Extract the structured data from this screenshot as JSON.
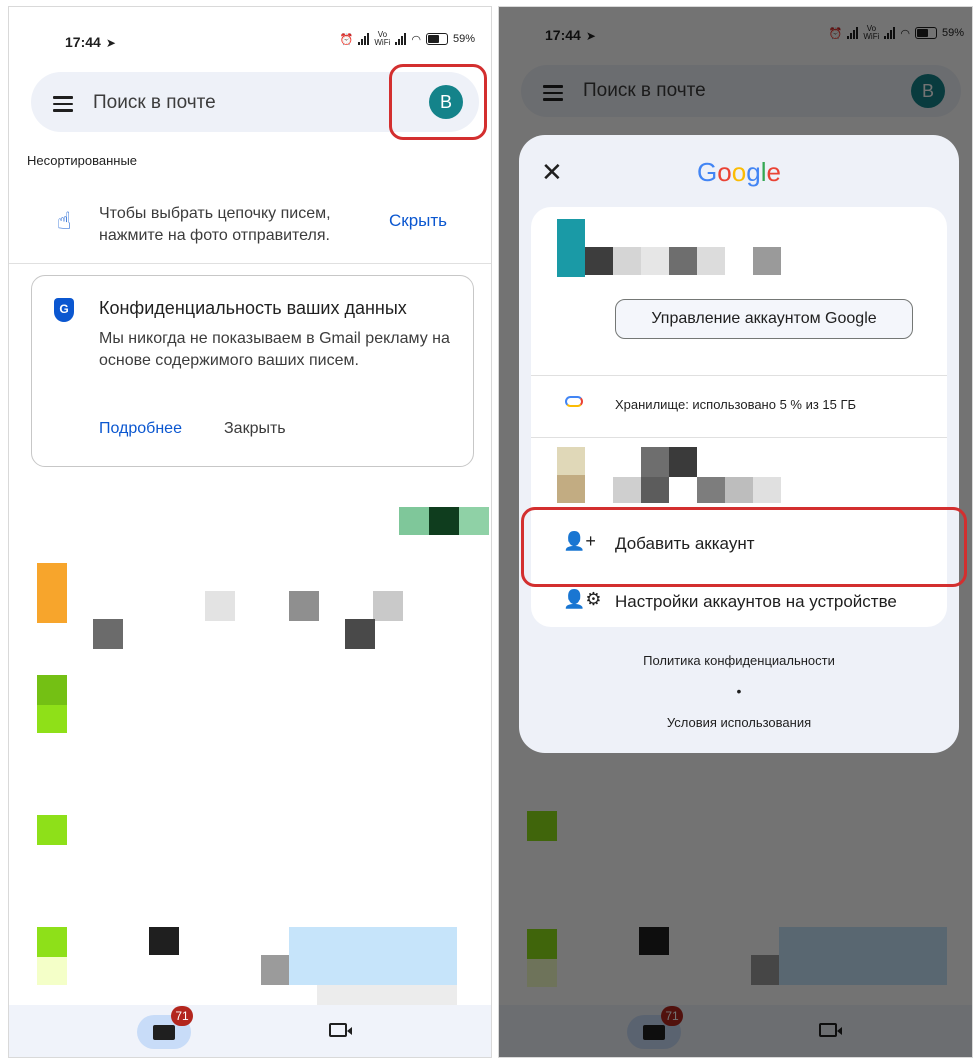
{
  "status_bar": {
    "time": "17:44",
    "vowifi_top": "Vo",
    "vowifi_bottom": "WiFi",
    "battery": "59%"
  },
  "search": {
    "placeholder": "Поиск в почте",
    "avatar_letter": "B",
    "avatar_color": "#14838a"
  },
  "inbox": {
    "category_label": "Несортированные",
    "hint_text": "Чтобы выбрать цепочку писем, нажмите на фото отправителя.",
    "hint_hide_label": "Скрыть"
  },
  "privacy_card": {
    "title": "Конфиденциальность ваших данных",
    "body": "Мы никогда не показываем в Gmail рекламу на основе содержимого ваших писем.",
    "more_label": "Подробнее",
    "close_label": "Закрыть"
  },
  "bottom_nav": {
    "mail_badge": "71"
  },
  "account_dialog": {
    "google_letters": [
      "G",
      "o",
      "o",
      "g",
      "l",
      "e"
    ],
    "google_colors": [
      "#4285f4",
      "#ea4335",
      "#fbbc04",
      "#4285f4",
      "#34a853",
      "#ea4335"
    ],
    "manage_button": "Управление аккаунтом Google",
    "storage_text": "Хранилище: использовано 5 % из 15 ГБ",
    "add_account": "Добавить аккаунт",
    "device_settings": "Настройки аккаунтов на устройстве",
    "privacy_policy": "Политика конфиденциальности",
    "separator_dot": "•",
    "terms": "Условия использования"
  },
  "highlight_color": "#d32f2f"
}
